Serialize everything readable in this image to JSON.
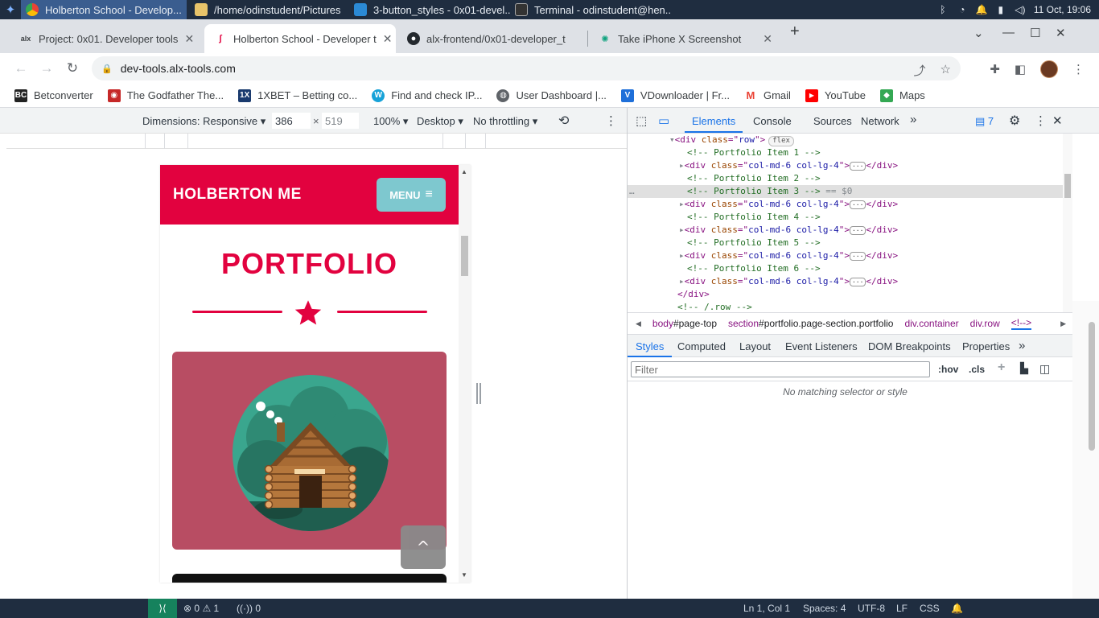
{
  "taskbar": {
    "tasks": [
      {
        "label": "Holberton School - Develop...",
        "active": true
      },
      {
        "label": "/home/odinstudent/Pictures",
        "active": false
      },
      {
        "label": "3-button_styles - 0x01-devel...",
        "active": false
      },
      {
        "label": "Terminal - odinstudent@hen...",
        "active": false
      }
    ],
    "clock": "11 Oct, 19:06"
  },
  "browser": {
    "tabs": [
      {
        "label": "Project: 0x01. Developer tools",
        "favicon": "alx"
      },
      {
        "label": "Holberton School - Developer t",
        "favicon": "H"
      },
      {
        "label": "alx-frontend/0x01-developer_t",
        "favicon": "github"
      },
      {
        "label": "Take iPhone X Screenshot",
        "favicon": "chatgpt"
      }
    ],
    "url": "dev-tools.alx-tools.com",
    "bookmarks": [
      {
        "label": "Betconverter",
        "icon": "BC",
        "color": "#222222"
      },
      {
        "label": "The Godfather The...",
        "icon": "gamepad",
        "color": "#c62828"
      },
      {
        "label": "1XBET – Betting co...",
        "icon": "1X",
        "color": "#1a3a6e"
      },
      {
        "label": "Find and check IP...",
        "icon": "W",
        "color": "#17a2d8"
      },
      {
        "label": "User Dashboard |...",
        "icon": "globe",
        "color": "#5f6368"
      },
      {
        "label": "VDownloader | Fr...",
        "icon": "V",
        "color": "#1e6fd9"
      },
      {
        "label": "Gmail",
        "icon": "M",
        "color": "#ea4335"
      },
      {
        "label": "YouTube",
        "icon": "▶",
        "color": "#ff0000"
      },
      {
        "label": "Maps",
        "icon": "map",
        "color": "#34a853"
      }
    ]
  },
  "device_toolbar": {
    "dimensions": "Dimensions: Responsive",
    "width": "386",
    "x": "×",
    "height": "519",
    "zoom": "100%",
    "device_type": "Desktop",
    "throttling": "No throttling"
  },
  "site": {
    "brand": "HOLBERTON ME",
    "menu_label": "MENU",
    "menu_icon": "≡",
    "section_title": "PORTFOLIO",
    "scroll_top_icon": "^"
  },
  "devtools": {
    "tabs": [
      "Elements",
      "Console",
      "Sources",
      "Network"
    ],
    "more": "»",
    "issues_count": "7",
    "dom": [
      {
        "indent": 1,
        "arrow": "▾",
        "tag": "div",
        "attr": "class",
        "val": "row",
        "badge": "flex",
        "close": false
      },
      {
        "indent": 2,
        "comment": "<!-- Portfolio Item 1 -->"
      },
      {
        "indent": 2,
        "arrow": "▸",
        "tag": "div",
        "attr": "class",
        "val": "col-md-6 col-lg-4",
        "collapsed": true
      },
      {
        "indent": 2,
        "comment": "<!-- Portfolio Item 2 -->"
      },
      {
        "indent": 2,
        "comment": "<!-- Portfolio Item 3 -->",
        "selected": true,
        "suffix": " == $0"
      },
      {
        "indent": 2,
        "arrow": "▸",
        "tag": "div",
        "attr": "class",
        "val": "col-md-6 col-lg-4",
        "collapsed": true
      },
      {
        "indent": 2,
        "comment": "<!-- Portfolio Item 4 -->"
      },
      {
        "indent": 2,
        "arrow": "▸",
        "tag": "div",
        "attr": "class",
        "val": "col-md-6 col-lg-4",
        "collapsed": true
      },
      {
        "indent": 2,
        "comment": "<!-- Portfolio Item 5 -->"
      },
      {
        "indent": 2,
        "arrow": "▸",
        "tag": "div",
        "attr": "class",
        "val": "col-md-6 col-lg-4",
        "collapsed": true
      },
      {
        "indent": 2,
        "comment": "<!-- Portfolio Item 6 -->"
      },
      {
        "indent": 2,
        "arrow": "▸",
        "tag": "div",
        "attr": "class",
        "val": "col-md-6 col-lg-4",
        "collapsed": true
      },
      {
        "indent": 1,
        "closing": "</div>"
      },
      {
        "indent": 1,
        "comment": "<!-- /.row -->"
      }
    ],
    "breadcrumbs": [
      {
        "tag": "body",
        "rest": "#page-top"
      },
      {
        "tag": "section",
        "rest": "#portfolio.page-section.portfolio"
      },
      {
        "tag": "div",
        "rest": ".container"
      },
      {
        "tag": "div",
        "rest": ".row"
      },
      {
        "tag": "<!--",
        "rest": ">"
      }
    ],
    "style_tabs": [
      "Styles",
      "Computed",
      "Layout",
      "Event Listeners",
      "DOM Breakpoints",
      "Properties"
    ],
    "filter_placeholder": "Filter",
    "hov": ":hov",
    "cls": ".cls",
    "no_match": "No matching selector or style"
  },
  "statusbar": {
    "problems": "0",
    "warnings": "1",
    "ports": "0",
    "position": "Ln 1, Col 1",
    "spaces": "Spaces: 4",
    "encoding": "UTF-8",
    "eol": "LF",
    "language": "CSS"
  },
  "colors": {
    "brand_red": "#e2023f",
    "menu_teal": "#7ec8cf",
    "card_bg": "#b84d63"
  }
}
